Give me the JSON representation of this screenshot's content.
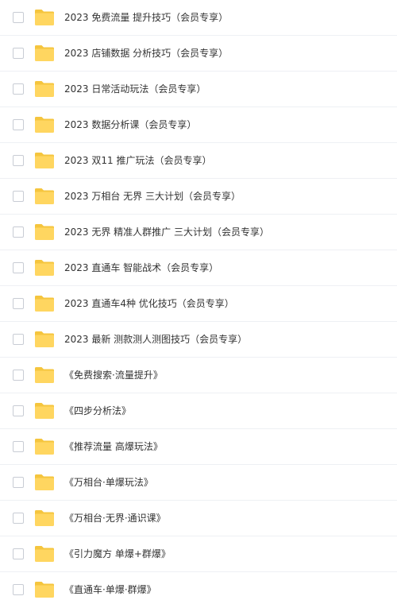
{
  "colors": {
    "folder_body": "#ffd660",
    "folder_tab": "#f5c53e",
    "text": "#333333",
    "row_divider": "#eef0f4",
    "checkbox_border": "#c8ccd4"
  },
  "icons": {
    "checkbox": "checkbox-icon",
    "folder": "folder-icon"
  },
  "files": [
    {
      "name": "2023 免费流量 提升技巧（会员专享）"
    },
    {
      "name": "2023 店铺数据 分析技巧（会员专享）"
    },
    {
      "name": "2023 日常活动玩法（会员专享）"
    },
    {
      "name": "2023 数据分析课（会员专享）"
    },
    {
      "name": "2023 双11 推广玩法（会员专享）"
    },
    {
      "name": "2023 万相台 无界 三大计划（会员专享）"
    },
    {
      "name": "2023 无界 精准人群推广 三大计划（会员专享）"
    },
    {
      "name": "2023 直通车 智能战术（会员专享）"
    },
    {
      "name": "2023 直通车4种 优化技巧（会员专享）"
    },
    {
      "name": "2023 最新 测款测人测图技巧（会员专享）"
    },
    {
      "name": "《免费搜索·流量提升》"
    },
    {
      "name": "《四步分析法》"
    },
    {
      "name": "《推荐流量 高爆玩法》"
    },
    {
      "name": "《万相台·单爆玩法》"
    },
    {
      "name": "《万相台·无界·通识课》"
    },
    {
      "name": "《引力魔方 单爆+群爆》"
    },
    {
      "name": "《直通车·单爆·群爆》"
    }
  ]
}
